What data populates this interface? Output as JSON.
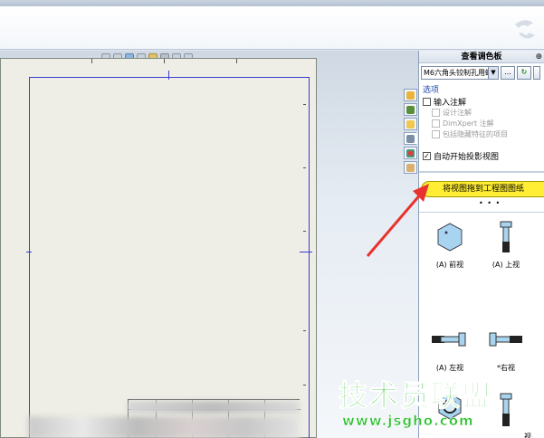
{
  "view_palette": {
    "title": "查看调色板",
    "pin": "⊕",
    "model_select": "M6六角头铰制孔用螺栓",
    "browse_button": "...",
    "refresh_button": "↻",
    "options": {
      "title": "选项",
      "import_annotations": {
        "label": "输入注解",
        "checked": false
      },
      "design_annotations": {
        "label": "设计注解",
        "checked": false
      },
      "dimxpert_annotations": {
        "label": "DimXpert 注解",
        "checked": false
      },
      "hidden_features": {
        "label": "包括隐藏特征的项目",
        "checked": false
      },
      "auto_projected": {
        "label": "自动开始投影视图",
        "checked": true,
        "mark": "✓"
      }
    },
    "drag_banner": "将视图拖到工程图图纸",
    "dots": "• • •",
    "views": [
      {
        "label": "(A) 前视"
      },
      {
        "label": "(A) 上视"
      },
      {
        "label": "(A) 左视"
      },
      {
        "label": "*右视"
      },
      {
        "label": ""
      },
      {
        "label": "视"
      }
    ]
  },
  "watermark": {
    "main": "技术员联盟",
    "url": "www.jsgho.com"
  },
  "colors": {
    "banner": "#ffee33",
    "sheet_border": "#3c3cd0",
    "arrow": "#e8322e",
    "watermark": "#2ec12e"
  }
}
